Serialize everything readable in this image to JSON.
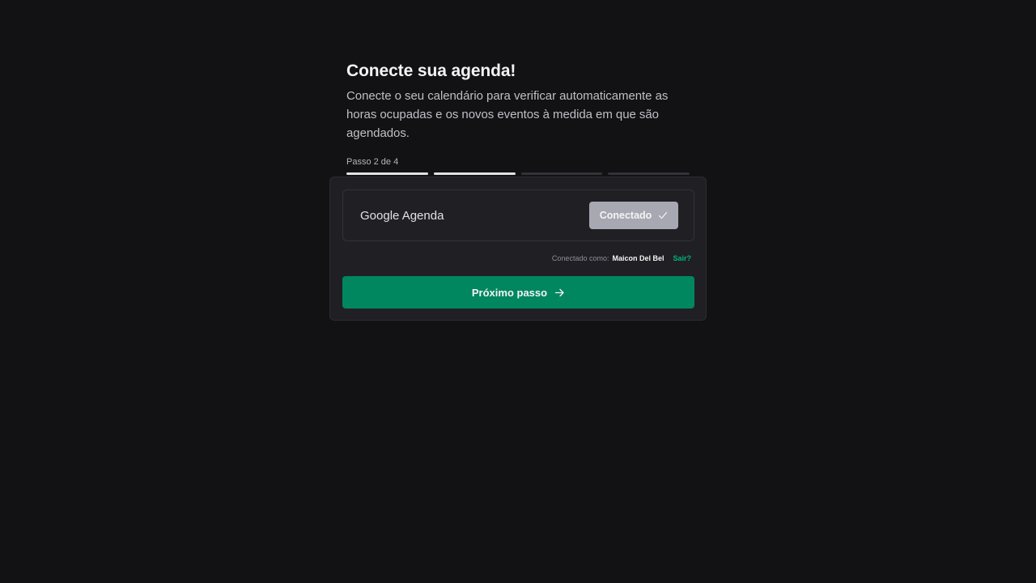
{
  "header": {
    "title": "Conecte sua agenda!",
    "subtitle": "Conecte o seu calendário para verificar automaticamente as horas ocupadas e os novos eventos à medida em que são agendados."
  },
  "steps": {
    "label": "Passo 2 de 4",
    "current": 2,
    "total": 4
  },
  "calendar": {
    "provider": "Google Agenda",
    "button_label": "Conectado",
    "button_icon": "check-icon",
    "connected_as_label": "Conectado como:",
    "user_name": "Maicon Del Bel",
    "signout_label": "Sair?"
  },
  "actions": {
    "next_label": "Próximo passo",
    "next_icon": "arrow-right-icon"
  },
  "colors": {
    "background": "#121214",
    "card": "#202024",
    "accent": "#00875f",
    "link": "#00b37e",
    "connected_button": "#a8a8b3"
  }
}
